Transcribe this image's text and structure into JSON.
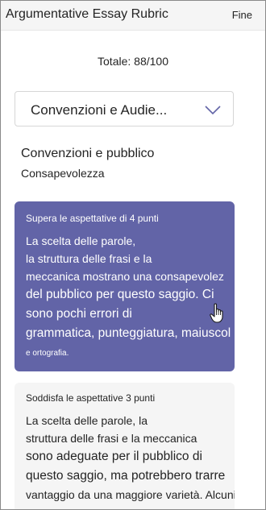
{
  "header": {
    "title": "Argumentative Essay Rubric",
    "done_label": "Fine"
  },
  "total": "Totale: 88/100",
  "dropdown": {
    "selected": "Convenzioni e Audie...",
    "icon": "chevron-down-icon"
  },
  "criterion": {
    "title": "Convenzioni e pubblico",
    "subtitle": "Consapevolezza"
  },
  "levels": [
    {
      "heading": "Supera le aspettative di 4 punti",
      "lines": [
        "La scelta delle parole,",
        "la struttura delle frasi e la",
        "meccanica mostrano una consapevolez",
        "del pubblico per questo saggio. Ci",
        "sono pochi errori di",
        "grammatica, punteggiatura, maiuscol",
        "e ortografia."
      ],
      "selected": true
    },
    {
      "heading": "Soddisfa le aspettative 3 punti",
      "lines": [
        "La scelta delle parole, la",
        "struttura delle frasi e la meccanica",
        "sono adeguate per il pubblico di",
        "questo saggio, ma potrebbero trarre",
        "vantaggio da una maggiore varietà. Alcuni piccoli"
      ],
      "selected": false
    }
  ],
  "colors": {
    "accent": "#6264a7",
    "header_bg": "#f5f5f5",
    "card_bg": "#f5f5f5"
  }
}
